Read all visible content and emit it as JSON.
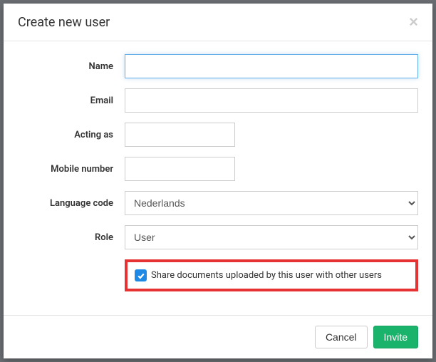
{
  "modal": {
    "title": "Create new user",
    "close_label": "×"
  },
  "form": {
    "name": {
      "label": "Name",
      "value": ""
    },
    "email": {
      "label": "Email",
      "value": ""
    },
    "acting_as": {
      "label": "Acting as",
      "value": ""
    },
    "mobile_number": {
      "label": "Mobile number",
      "value": ""
    },
    "language_code": {
      "label": "Language code",
      "value": "Nederlands"
    },
    "role": {
      "label": "Role",
      "value": "User"
    },
    "share_docs": {
      "label": "Share documents uploaded by this user with other users",
      "checked": true
    }
  },
  "footer": {
    "cancel": "Cancel",
    "invite": "Invite"
  }
}
